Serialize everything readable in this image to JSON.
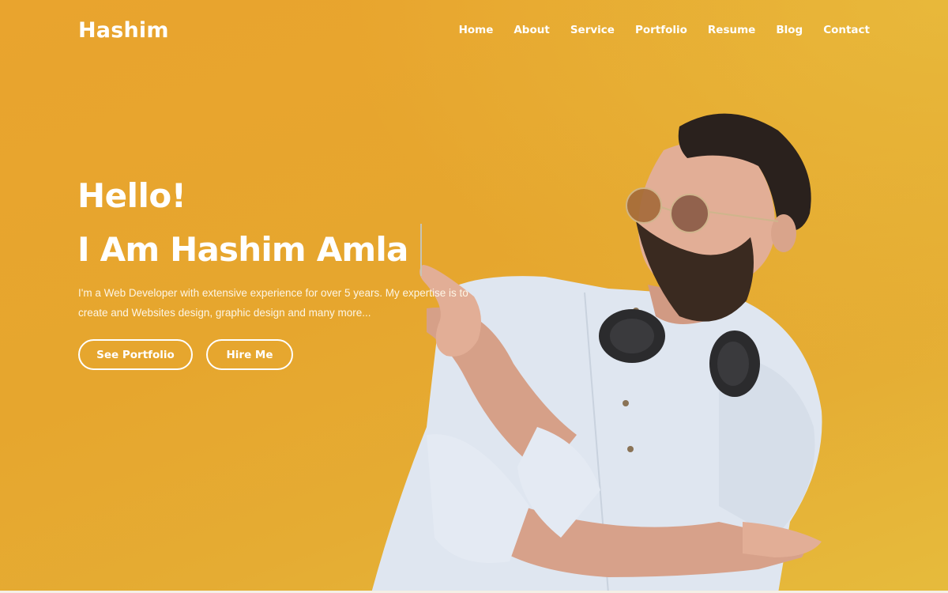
{
  "header": {
    "logo": "Hashim",
    "nav": [
      {
        "label": "Home"
      },
      {
        "label": "About"
      },
      {
        "label": "Service"
      },
      {
        "label": "Portfolio"
      },
      {
        "label": "Resume"
      },
      {
        "label": "Blog"
      },
      {
        "label": "Contact"
      }
    ]
  },
  "hero": {
    "greeting": "Hello!",
    "headline": "I Am Hashim Amla",
    "description": "I'm a Web Developer with extensive experience for over 5 years. My expertise is to create and Websites design, graphic design and many more...",
    "buttons": {
      "portfolio": "See Portfolio",
      "hire": "Hire Me"
    },
    "image_alt": "Bearded man with sunglasses and headphones pointing at the headline"
  },
  "colors": {
    "background": "#e7a62e",
    "text": "#ffffff",
    "shirt": "#dfe6f0"
  }
}
